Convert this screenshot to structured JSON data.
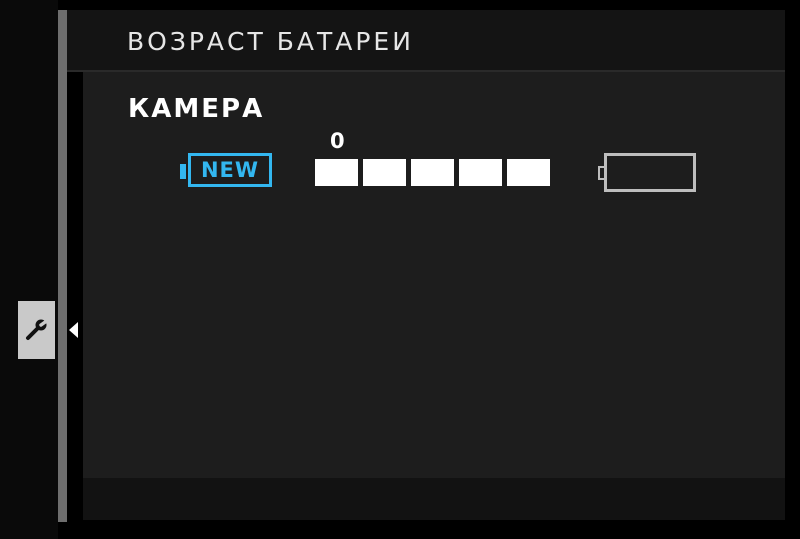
{
  "header": {
    "title": "ВОЗРАСТ БАТАРЕИ"
  },
  "sidebar": {
    "active_tab_icon": "wrench-icon"
  },
  "battery_age": {
    "section_label": "КАМЕРА",
    "new_label": "NEW",
    "scale_start_label": "0",
    "segments_filled": 5,
    "segments_total": 5,
    "new_icon_color": "#33b7f0"
  }
}
